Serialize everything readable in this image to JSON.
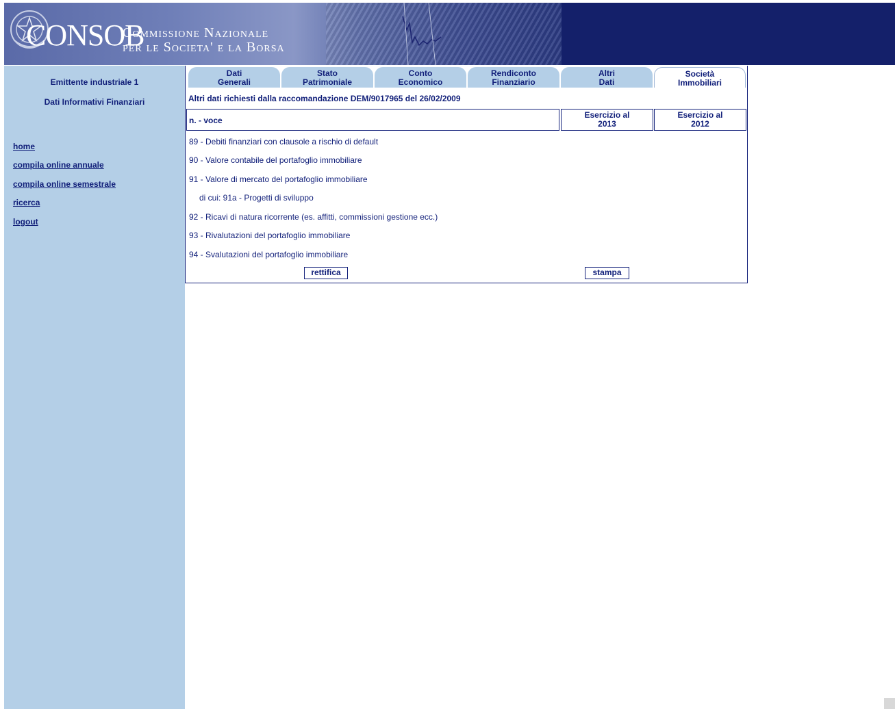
{
  "header": {
    "logo_text": "CONSOB",
    "subtitle_line1": "Commissione Nazionale",
    "subtitle_line2": "per le Societa' e la Borsa"
  },
  "sidebar": {
    "company": "Emittente industriale 1",
    "section": "Dati Informativi Finanziari",
    "links": [
      "home",
      "compila online annuale",
      "compila online semestrale",
      "ricerca",
      "logout"
    ]
  },
  "tabs": [
    {
      "line1": "Dati",
      "line2": "Generali"
    },
    {
      "line1": "Stato",
      "line2": "Patrimoniale"
    },
    {
      "line1": "Conto",
      "line2": "Economico"
    },
    {
      "line1": "Rendiconto",
      "line2": "Finanziario"
    },
    {
      "line1": "Altri",
      "line2": "Dati"
    },
    {
      "line1": "Società",
      "line2": "Immobiliari"
    }
  ],
  "active_tab": "Società Immobiliari",
  "main": {
    "subtitle": "Altri dati richiesti dalla raccomandazione DEM/9017965 del 26/02/2009",
    "col_voce": "n. - voce",
    "col_year1": {
      "line1": "Esercizio al",
      "line2": "2013"
    },
    "col_year2": {
      "line1": "Esercizio al",
      "line2": "2012"
    },
    "rows": [
      "89 - Debiti finanziari con clausole a rischio di default",
      "90 - Valore contabile del portafoglio immobiliare",
      "91 - Valore di mercato del portafoglio immobiliare",
      "di cui: 91a - Progetti di sviluppo",
      "92 - Ricavi di natura ricorrente (es. affitti, commissioni gestione ecc.)",
      "93 - Rivalutazioni del portafoglio immobiliare",
      "94 - Svalutazioni del portafoglio immobiliare"
    ],
    "btn_rettifica": "rettifica",
    "btn_stampa": "stampa"
  },
  "colors": {
    "navy": "#12207a",
    "sidebar": "#b4cfe7",
    "banner": "#14206a"
  }
}
